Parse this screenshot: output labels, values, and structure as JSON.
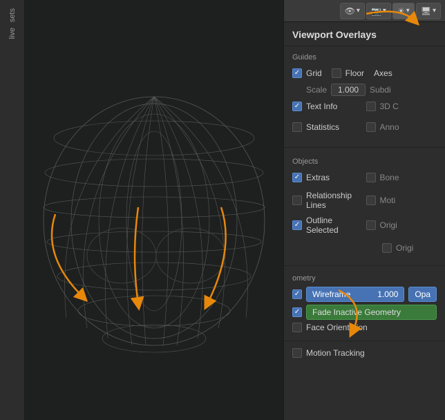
{
  "toolbar": {
    "viewport_overlays_label": "Viewport Overlays",
    "buttons": [
      "👁",
      "▾",
      "📷",
      "▾",
      "☀",
      "▾",
      "🖥",
      "▾"
    ]
  },
  "left_sidebar": {
    "sets_label": "sets",
    "live_label": "live"
  },
  "sections": {
    "guides": {
      "title": "Guides",
      "grid_label": "Grid",
      "floor_label": "Floor",
      "axes_label": "Axes",
      "scale_label": "Scale",
      "scale_value": "1.000",
      "subdi_label": "Subdi",
      "text_info_label": "Text Info",
      "three_d_c_label": "3D C",
      "statistics_label": "Statistics",
      "anno_label": "Anno"
    },
    "objects": {
      "title": "Objects",
      "extras_label": "Extras",
      "bone_label": "Bone",
      "relationship_lines_label": "Relationship Lines",
      "moti_label": "Moti",
      "outline_selected_label": "Outline Selected",
      "origi_label1": "Origi",
      "origi_label2": "Origi"
    },
    "geometry": {
      "title": "ometry",
      "wireframe_label": "Wireframe",
      "wireframe_value": "1.000",
      "opa_label": "Opa",
      "fade_inactive_label": "Fade Inactive Geometry",
      "face_orientation_label": "Face Orientation"
    },
    "motion_tracking": {
      "title": "Motion Tracking"
    }
  }
}
